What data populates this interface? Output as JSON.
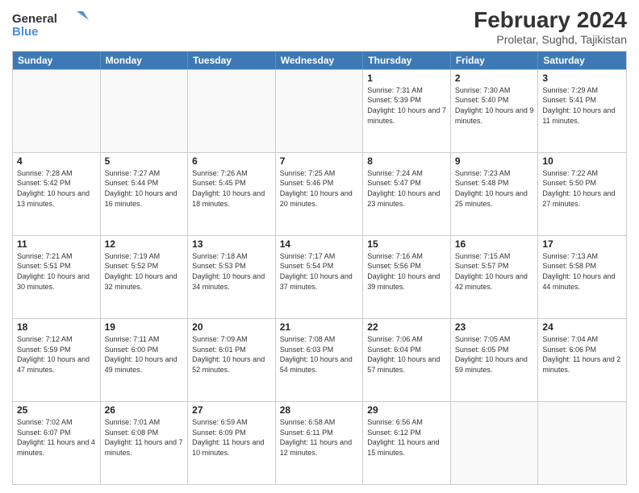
{
  "logo": {
    "line1": "General",
    "line2": "Blue"
  },
  "title": "February 2024",
  "subtitle": "Proletar, Sughd, Tajikistan",
  "days_of_week": [
    "Sunday",
    "Monday",
    "Tuesday",
    "Wednesday",
    "Thursday",
    "Friday",
    "Saturday"
  ],
  "weeks": [
    [
      {
        "day": "",
        "info": ""
      },
      {
        "day": "",
        "info": ""
      },
      {
        "day": "",
        "info": ""
      },
      {
        "day": "",
        "info": ""
      },
      {
        "day": "1",
        "sunrise": "7:31 AM",
        "sunset": "5:39 PM",
        "daylight": "10 hours and 7 minutes."
      },
      {
        "day": "2",
        "sunrise": "7:30 AM",
        "sunset": "5:40 PM",
        "daylight": "10 hours and 9 minutes."
      },
      {
        "day": "3",
        "sunrise": "7:29 AM",
        "sunset": "5:41 PM",
        "daylight": "10 hours and 11 minutes."
      }
    ],
    [
      {
        "day": "4",
        "sunrise": "7:28 AM",
        "sunset": "5:42 PM",
        "daylight": "10 hours and 13 minutes."
      },
      {
        "day": "5",
        "sunrise": "7:27 AM",
        "sunset": "5:44 PM",
        "daylight": "10 hours and 16 minutes."
      },
      {
        "day": "6",
        "sunrise": "7:26 AM",
        "sunset": "5:45 PM",
        "daylight": "10 hours and 18 minutes."
      },
      {
        "day": "7",
        "sunrise": "7:25 AM",
        "sunset": "5:46 PM",
        "daylight": "10 hours and 20 minutes."
      },
      {
        "day": "8",
        "sunrise": "7:24 AM",
        "sunset": "5:47 PM",
        "daylight": "10 hours and 23 minutes."
      },
      {
        "day": "9",
        "sunrise": "7:23 AM",
        "sunset": "5:48 PM",
        "daylight": "10 hours and 25 minutes."
      },
      {
        "day": "10",
        "sunrise": "7:22 AM",
        "sunset": "5:50 PM",
        "daylight": "10 hours and 27 minutes."
      }
    ],
    [
      {
        "day": "11",
        "sunrise": "7:21 AM",
        "sunset": "5:51 PM",
        "daylight": "10 hours and 30 minutes."
      },
      {
        "day": "12",
        "sunrise": "7:19 AM",
        "sunset": "5:52 PM",
        "daylight": "10 hours and 32 minutes."
      },
      {
        "day": "13",
        "sunrise": "7:18 AM",
        "sunset": "5:53 PM",
        "daylight": "10 hours and 34 minutes."
      },
      {
        "day": "14",
        "sunrise": "7:17 AM",
        "sunset": "5:54 PM",
        "daylight": "10 hours and 37 minutes."
      },
      {
        "day": "15",
        "sunrise": "7:16 AM",
        "sunset": "5:56 PM",
        "daylight": "10 hours and 39 minutes."
      },
      {
        "day": "16",
        "sunrise": "7:15 AM",
        "sunset": "5:57 PM",
        "daylight": "10 hours and 42 minutes."
      },
      {
        "day": "17",
        "sunrise": "7:13 AM",
        "sunset": "5:58 PM",
        "daylight": "10 hours and 44 minutes."
      }
    ],
    [
      {
        "day": "18",
        "sunrise": "7:12 AM",
        "sunset": "5:59 PM",
        "daylight": "10 hours and 47 minutes."
      },
      {
        "day": "19",
        "sunrise": "7:11 AM",
        "sunset": "6:00 PM",
        "daylight": "10 hours and 49 minutes."
      },
      {
        "day": "20",
        "sunrise": "7:09 AM",
        "sunset": "6:01 PM",
        "daylight": "10 hours and 52 minutes."
      },
      {
        "day": "21",
        "sunrise": "7:08 AM",
        "sunset": "6:03 PM",
        "daylight": "10 hours and 54 minutes."
      },
      {
        "day": "22",
        "sunrise": "7:06 AM",
        "sunset": "6:04 PM",
        "daylight": "10 hours and 57 minutes."
      },
      {
        "day": "23",
        "sunrise": "7:05 AM",
        "sunset": "6:05 PM",
        "daylight": "10 hours and 59 minutes."
      },
      {
        "day": "24",
        "sunrise": "7:04 AM",
        "sunset": "6:06 PM",
        "daylight": "11 hours and 2 minutes."
      }
    ],
    [
      {
        "day": "25",
        "sunrise": "7:02 AM",
        "sunset": "6:07 PM",
        "daylight": "11 hours and 4 minutes."
      },
      {
        "day": "26",
        "sunrise": "7:01 AM",
        "sunset": "6:08 PM",
        "daylight": "11 hours and 7 minutes."
      },
      {
        "day": "27",
        "sunrise": "6:59 AM",
        "sunset": "6:09 PM",
        "daylight": "11 hours and 10 minutes."
      },
      {
        "day": "28",
        "sunrise": "6:58 AM",
        "sunset": "6:11 PM",
        "daylight": "11 hours and 12 minutes."
      },
      {
        "day": "29",
        "sunrise": "6:56 AM",
        "sunset": "6:12 PM",
        "daylight": "11 hours and 15 minutes."
      },
      {
        "day": "",
        "info": ""
      },
      {
        "day": "",
        "info": ""
      }
    ]
  ]
}
